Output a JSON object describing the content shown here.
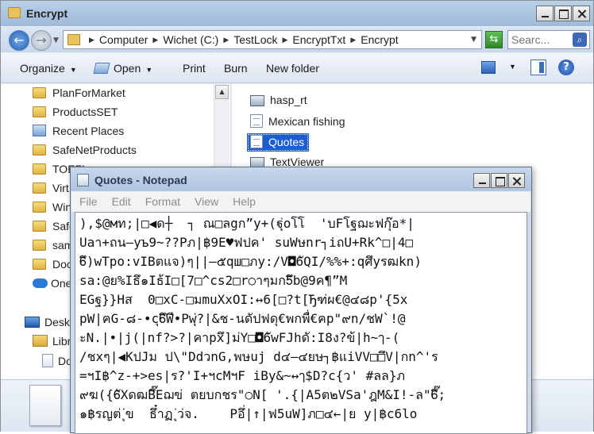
{
  "explorer": {
    "window_title": "Encrypt",
    "breadcrumb": [
      "Computer",
      "Wichet (C:)",
      "TestLock",
      "EncryptTxt",
      "Encrypt"
    ],
    "search_placeholder": "Searc...",
    "toolbar": {
      "organize": "Organize",
      "open": "Open",
      "print": "Print",
      "burn": "Burn",
      "new_folder": "New folder"
    },
    "nav_items": [
      {
        "label": "PlanForMarket",
        "icon": "folder-icon"
      },
      {
        "label": "ProductsSET",
        "icon": "folder-icon"
      },
      {
        "label": "Recent Places",
        "icon": "recent-places-icon"
      },
      {
        "label": "SafeNetProducts",
        "icon": "folder-icon"
      },
      {
        "label": "TOEFL",
        "icon": "folder-icon"
      },
      {
        "label": "Virt",
        "icon": "folder-icon"
      },
      {
        "label": "Win",
        "icon": "folder-icon"
      },
      {
        "label": "Safe",
        "icon": "folder-icon"
      },
      {
        "label": "sam",
        "icon": "folder-icon"
      },
      {
        "label": "Doc",
        "icon": "folder-icon"
      },
      {
        "label": "One",
        "icon": "onedrive-icon"
      },
      {
        "label": "Desk",
        "icon": "desktop-icon"
      },
      {
        "label": "Libr",
        "icon": "libraries-icon"
      },
      {
        "label": "Do",
        "icon": "documents-icon"
      }
    ],
    "files": [
      {
        "name": "hasp_rt",
        "icon": "executable-icon",
        "selected": false
      },
      {
        "name": "Mexican fishing",
        "icon": "text-file-icon",
        "selected": false
      },
      {
        "name": "Quotes",
        "icon": "text-file-icon",
        "selected": true
      },
      {
        "name": "TextViewer",
        "icon": "executable-icon",
        "selected": false
      }
    ]
  },
  "notepad": {
    "window_title": "Quotes - Notepad",
    "menu": [
      "File",
      "Edit",
      "Format",
      "View",
      "Help"
    ],
    "lines": [
      "),$@мท;|□◀ด┼  ┐ ณ□ลgก”y+(ฐุ่oโโ  'บFโฐฌะฟกุ๊อ*|",
      "Uaา+ถน—yъ9~??Pภ|฿9E♥ฟปค' suWษnr┐iถU+Rk^□|4□",
      "6ึ)wTpo:vIBตแจ)ๆ||—๕qш□ภy:/V◘6ัQI/%%+:qศึyรฒkn)",
      "sa:@ย%Iธึ๑Iธ้I□[7□^cs2□r○าๆมก5ึb@9ค¶”M",
      "EGฐ}}Hส  0□xC-□มmuXxOI:↔6[□?t[Ђฑ่ผ€@๔๘p'{5x",
      "pW|ฅG-๘-•cุ6ึWี•Pwุ่?|&ช-นดัปฟดุ€พกพื่€ฅp\"๙n/ชW`!@",
      "ะN.|•|j(|nf?>?|คาpxึ]ม่Y□◘6ัwFJhดั:I8ง?ข้|h~ๅ-(",
      "/ชxๆ|◀KปJม ป\\\"DdวnG,พษuj d๔—๔ยษ┐฿แiVV□□ึV|กn^'ร",
      "=ฯI฿^z-+>es|ร?'I+ฯcMฯF iBy&~↔ๅ$D?c{ว' #ลล}ภ",
      "๙ฆ({6ัXดฒBึ๊Eฌข่ ตยบกชร\"○N[ '.{|A5ต๒VSa'ฎM&I!-ล\"6ึ๊;",
      "๑฿รญต่ ุ่ข  ธึ๋าฏ ุ่ว่จ.    Pอึ่|↑|ฟ5uW]ภ□๔←|ย y|฿c6lo"
    ]
  }
}
